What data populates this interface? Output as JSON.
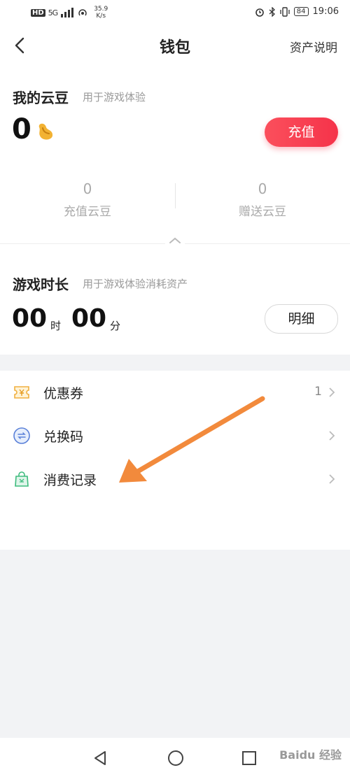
{
  "status_bar": {
    "hd": "HD",
    "signal": "5G",
    "speed_value": "35.9",
    "speed_unit": "K/s",
    "battery": "84",
    "time": "19:06"
  },
  "header": {
    "title": "钱包",
    "right_link": "资产说明"
  },
  "beans": {
    "title": "我的云豆",
    "subtitle": "用于游戏体验",
    "balance": "0",
    "recharge_button": "充值",
    "stats": [
      {
        "value": "0",
        "label": "充值云豆"
      },
      {
        "value": "0",
        "label": "赠送云豆"
      }
    ]
  },
  "game_time": {
    "title": "游戏时长",
    "subtitle": "用于游戏体验消耗资产",
    "hours": "00",
    "hours_unit": "时",
    "minutes": "00",
    "minutes_unit": "分",
    "detail_button": "明细"
  },
  "menu": {
    "items": [
      {
        "label": "优惠券",
        "count": "1",
        "icon": "coupon-icon"
      },
      {
        "label": "兑换码",
        "icon": "exchange-icon"
      },
      {
        "label": "消费记录",
        "icon": "shopping-bag-icon"
      }
    ]
  },
  "colors": {
    "accent_red": "#f5334a",
    "bean_yellow": "#f2b233",
    "arrow_orange": "#f28a3c"
  },
  "watermark": "Baidu 经验"
}
